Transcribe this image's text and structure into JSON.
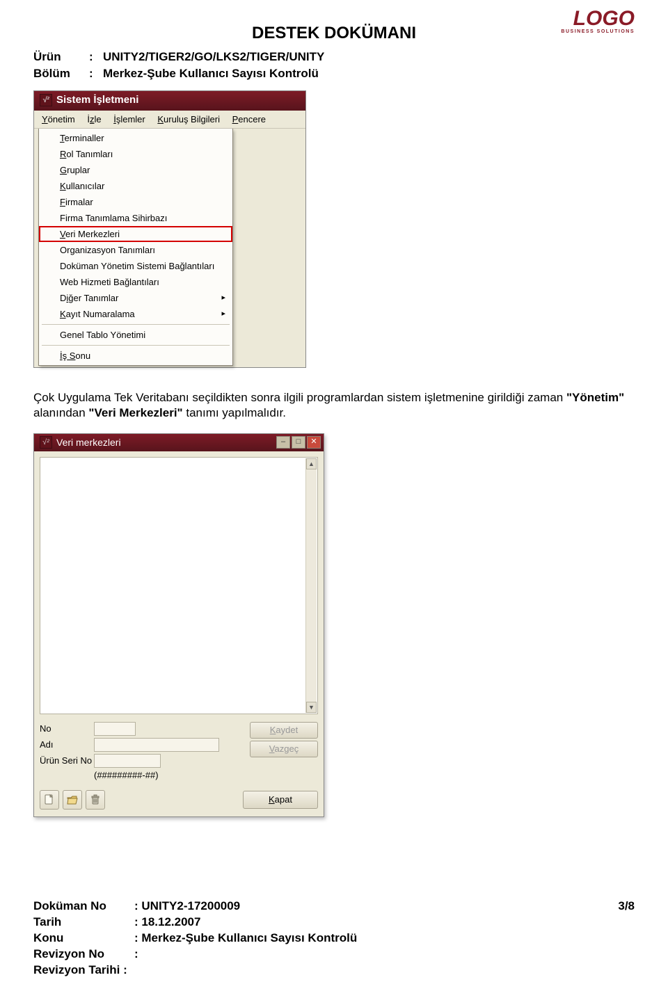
{
  "logo": {
    "main": "LOGO",
    "sub": "BUSINESS SOLUTIONS"
  },
  "doc_title": "DESTEK DOKÜMANI",
  "header": {
    "urun_label": "Ürün",
    "urun_value": "UNITY2/TIGER2/GO/LKS2/TIGER/UNITY",
    "bolum_label": "Bölüm",
    "bolum_value": "Merkez-Şube Kullanıcı Sayısı Kontrolü",
    "sep": ":"
  },
  "win1": {
    "title": "Sistem İşletmeni",
    "icon_text": "√²",
    "menubar": {
      "yonetim": "Yönetim",
      "izle": "İzle",
      "islemler": "İşlemler",
      "kurulus": "Kuruluş Bilgileri",
      "pencere": "Pencere"
    },
    "items": {
      "terminaller": "Terminaller",
      "rol": "Rol Tanımları",
      "gruplar": "Gruplar",
      "kullanicilar": "Kullanıcılar",
      "firmalar": "Firmalar",
      "firmatanimsihir": "Firma Tanımlama Sihirbazı",
      "verimerkezleri": "Veri Merkezleri",
      "organizasyon": "Organizasyon Tanımları",
      "dokumanyonetim": "Doküman Yönetim Sistemi Bağlantıları",
      "webhizmeti": "Web Hizmeti Bağlantıları",
      "diger": "Diğer Tanımlar",
      "kayitnum": "Kayıt Numaralama",
      "geneltablo": "Genel Tablo Yönetimi",
      "issonu": "İş Sonu"
    }
  },
  "para": {
    "t1": "Çok Uygulama Tek Veritabanı seçildikten sonra ilgili programlardan sistem işletmenine girildiği zaman ",
    "b1": "\"Yönetim\"",
    "t2": " alanından ",
    "b2": "\"Veri Merkezleri\"",
    "t3": " tanımı yapılmalıdır."
  },
  "win2": {
    "title": "Veri merkezleri",
    "icon_text": "√²",
    "labels": {
      "no": "No",
      "adi": "Adı",
      "seri": "Ürün Seri No"
    },
    "hint": "(#########-##)",
    "buttons": {
      "kaydet": "Kaydet",
      "vazgec": "Vazgeç",
      "kapat": "Kapat"
    }
  },
  "footer": {
    "dokuman_no_label": "Doküman No",
    "dokuman_no": ": UNITY2-17200009",
    "tarih_label": "Tarih",
    "tarih": ": 18.12.2007",
    "konu_label": "Konu",
    "konu": ": Merkez-Şube Kullanıcı Sayısı Kontrolü",
    "revno_label": "Revizyon No",
    "revno": ":",
    "revtarih_label": "Revizyon Tarihi :",
    "page": "3/8"
  }
}
